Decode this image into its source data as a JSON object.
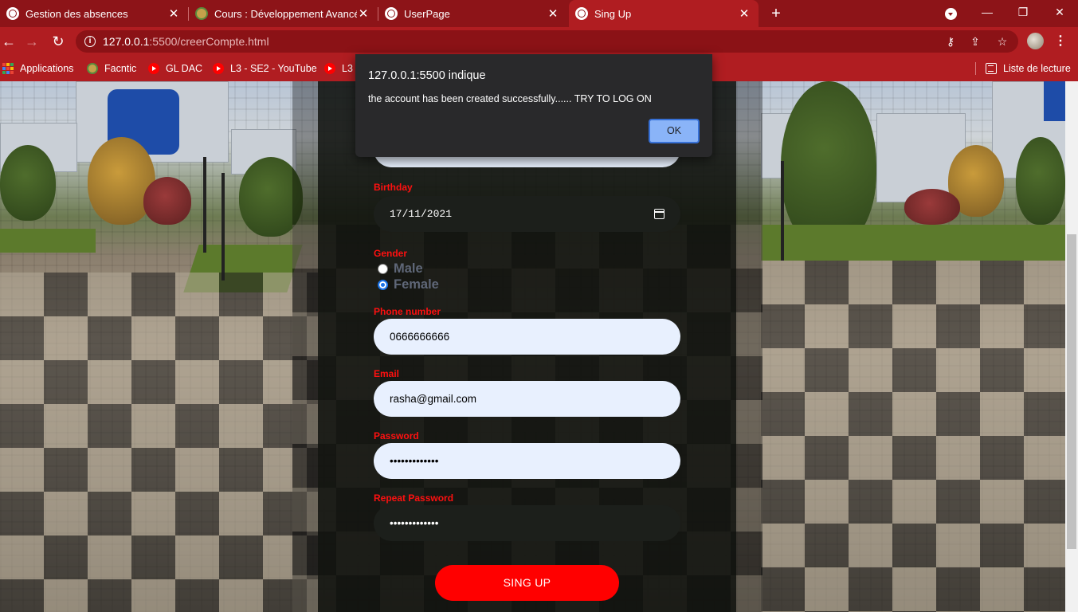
{
  "browser": {
    "tabs": [
      {
        "label": "Gestion des absences",
        "icon": "globe-icon",
        "active": false
      },
      {
        "label": "Cours : Développement Avancé c",
        "icon": "moodle-icon",
        "active": false
      },
      {
        "label": "UserPage",
        "icon": "globe-icon",
        "active": false
      },
      {
        "label": "Sing Up",
        "icon": "globe-icon",
        "active": true
      }
    ],
    "new_tab": "+",
    "url_host": "127.0.0.1",
    "url_rest": ":5500/creerCompte.html",
    "bookmarks": [
      {
        "label": "Applications",
        "icon": "apps-grid-icon"
      },
      {
        "label": "Facntic",
        "icon": "moodle-icon"
      },
      {
        "label": "GL DAC",
        "icon": "youtube-icon"
      },
      {
        "label": "L3 - SE2 - YouTube",
        "icon": "youtube-icon"
      },
      {
        "label": "L3",
        "icon": "youtube-icon"
      }
    ],
    "reading_list": "Liste de lecture"
  },
  "form": {
    "birthday_label": "Birthday",
    "birthday_value": "17/11/2021",
    "gender_label": "Gender",
    "gender_options": [
      {
        "label": "Male",
        "checked": false
      },
      {
        "label": "Female",
        "checked": true
      }
    ],
    "phone_label": "Phone number",
    "phone_value": "0666666666",
    "email_label": "Email",
    "email_value": "rasha@gmail.com",
    "password_label": "Password",
    "password_value": "•••••••••••••",
    "repeat_password_label": "Repeat Password",
    "repeat_password_value": "•••••••••••••",
    "submit_label": "SING UP"
  },
  "dialog": {
    "title": "127.0.0.1:5500 indique",
    "message": "the account has been created successfully...... TRY TO LOG ON",
    "ok_label": "OK"
  },
  "colors": {
    "chrome_dark": "#8d1418",
    "chrome": "#b01d21",
    "label_red": "#ff1010",
    "button_red": "#ff0000",
    "dialog_bg": "#29292b",
    "ok_button": "#8ab4f8"
  }
}
